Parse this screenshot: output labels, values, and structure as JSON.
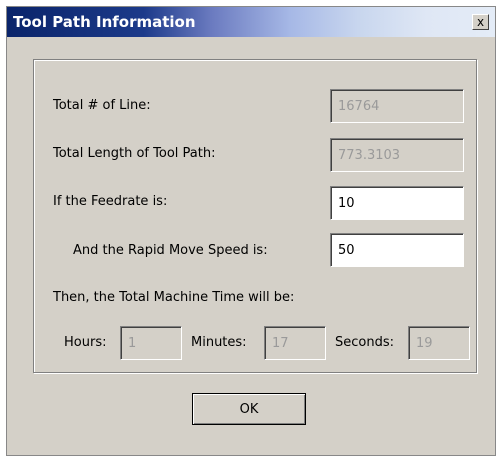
{
  "window": {
    "title": "Tool Path Information",
    "close_glyph": "x"
  },
  "form": {
    "total_lines": {
      "label": "Total # of Line:",
      "value": "16764"
    },
    "total_length": {
      "label": "Total Length of Tool Path:",
      "value": "773.3103"
    },
    "feedrate": {
      "label": "If the Feedrate is:",
      "value": "10"
    },
    "rapid_speed": {
      "label": "And the Rapid Move Speed is:",
      "value": "50"
    },
    "result_caption": "Then, the Total Machine Time will be:",
    "hours": {
      "label": "Hours:",
      "value": "1"
    },
    "minutes": {
      "label": "Minutes:",
      "value": "17"
    },
    "seconds": {
      "label": "Seconds:",
      "value": "19"
    }
  },
  "buttons": {
    "ok_label": "OK"
  },
  "colors": {
    "titlebar_start": "#0a246a",
    "dialog_face": "#d4d0c8",
    "disabled_text": "#9a9a9a"
  }
}
